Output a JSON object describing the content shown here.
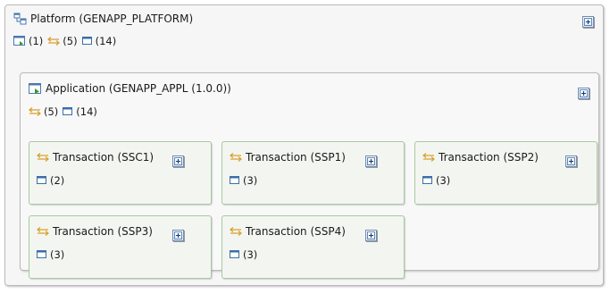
{
  "platform": {
    "title": "Platform (GENAPP_PLATFORM)",
    "stats": [
      {
        "icon": "application-icon",
        "value": "(1)"
      },
      {
        "icon": "transaction-icon",
        "value": "(5)"
      },
      {
        "icon": "resource-icon",
        "value": "(14)"
      }
    ]
  },
  "application": {
    "title": "Application (GENAPP_APPL (1.0.0))",
    "stats": [
      {
        "icon": "transaction-icon",
        "value": "(5)"
      },
      {
        "icon": "resource-icon",
        "value": "(14)"
      }
    ]
  },
  "transactions": [
    {
      "title": "Transaction (SSC1)",
      "count": "(2)"
    },
    {
      "title": "Transaction (SSP1)",
      "count": "(3)"
    },
    {
      "title": "Transaction (SSP2)",
      "count": "(3)"
    },
    {
      "title": "Transaction (SSP3)",
      "count": "(3)"
    },
    {
      "title": "Transaction (SSP4)",
      "count": "(3)"
    }
  ],
  "colors": {
    "transaction_arrow": "#d9a030",
    "resource_icon": "#3a6ea8",
    "application_icon": "#4a78b0",
    "transaction_border": "#a8c8a0"
  }
}
